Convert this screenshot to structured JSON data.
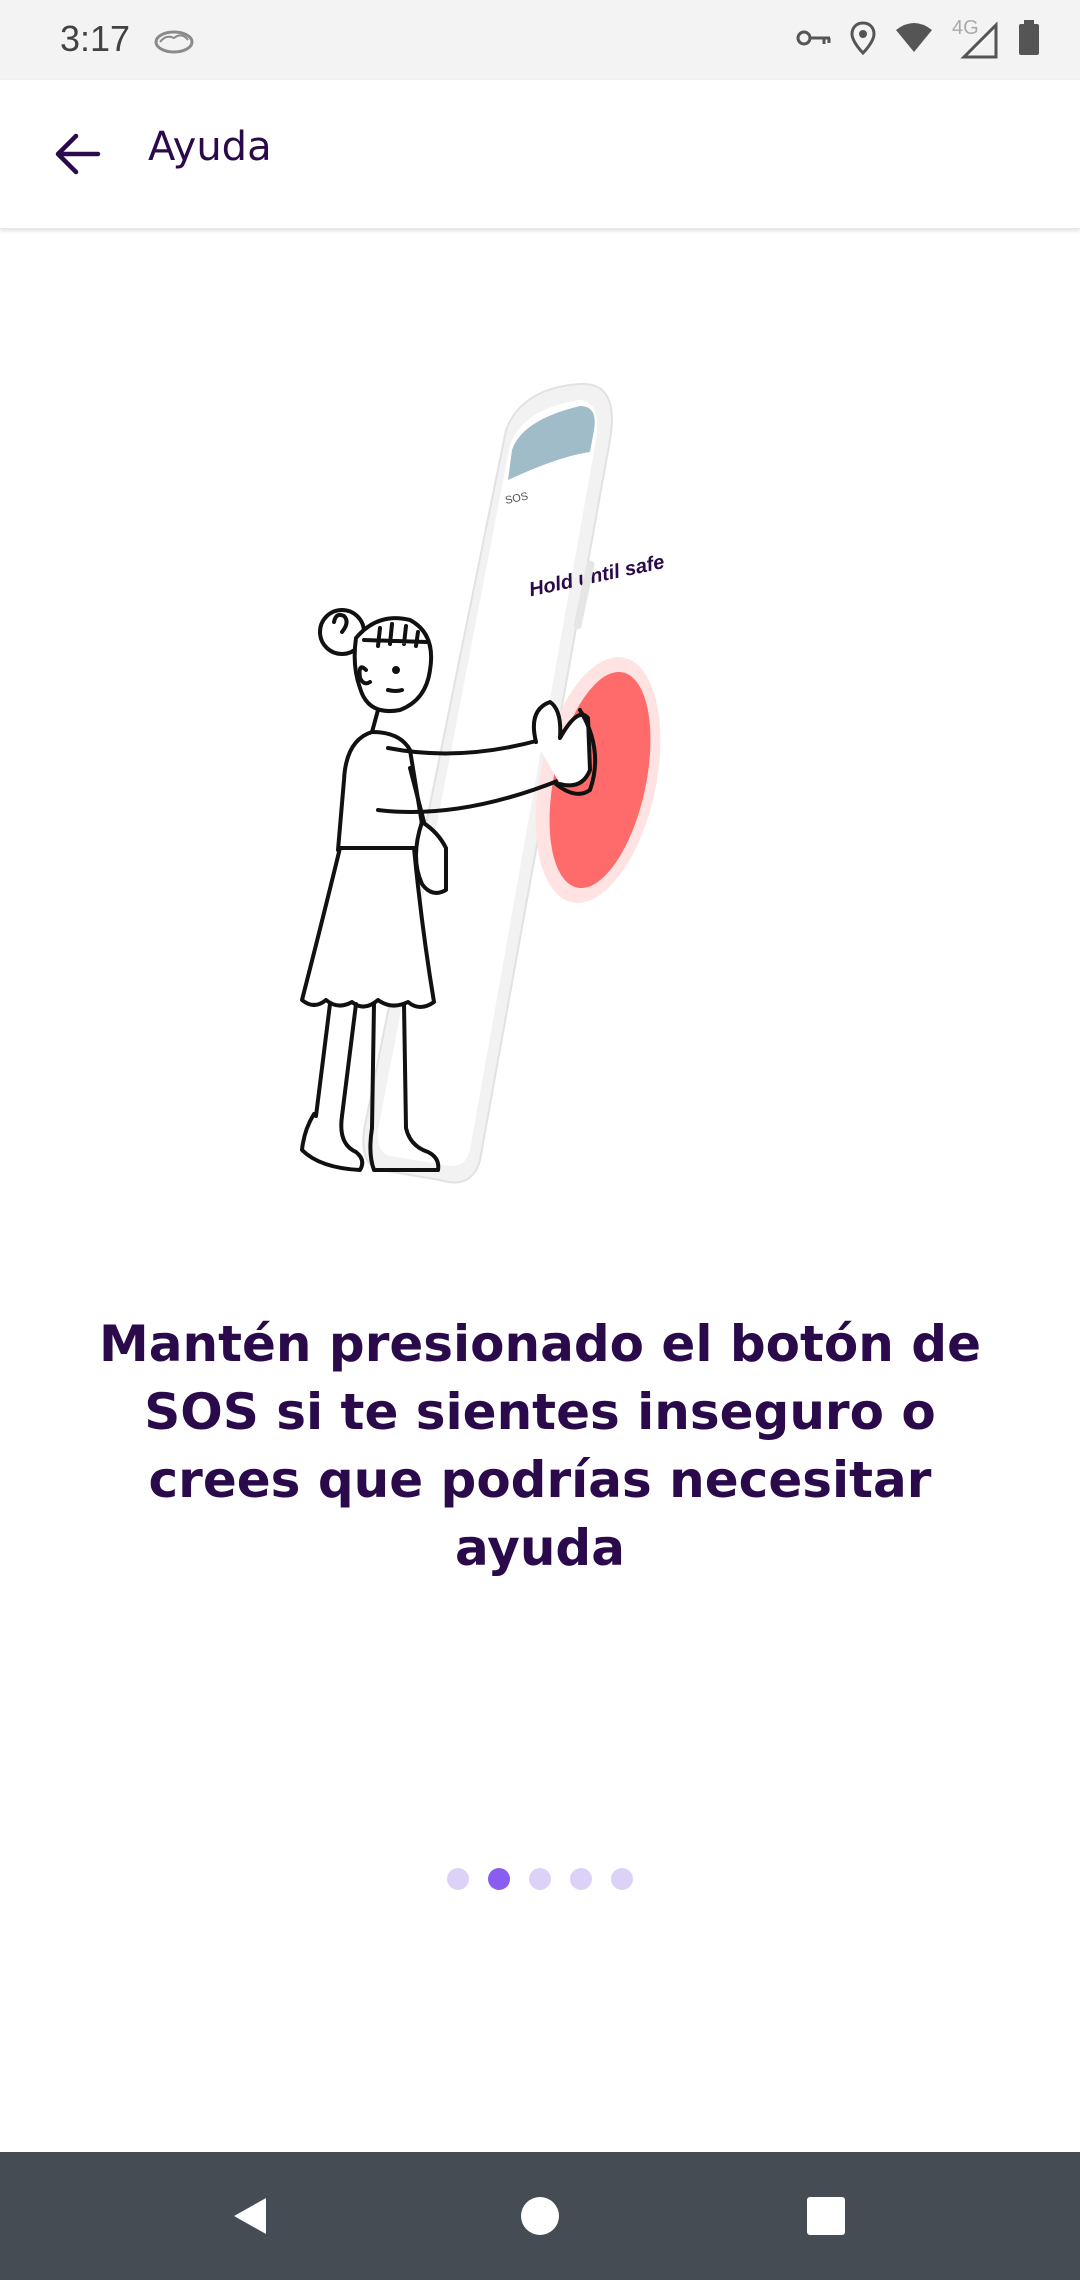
{
  "status_bar": {
    "time": "3:17",
    "network_label": "4G",
    "icons": [
      "weather-icon",
      "vpn-key-icon",
      "location-icon",
      "wifi-icon",
      "signal-icon",
      "battery-icon"
    ]
  },
  "app_bar": {
    "title": "Ayuda",
    "back_icon": "arrow-back-icon"
  },
  "onboarding": {
    "illustration": {
      "screen_title": "Hold until safe",
      "screen_header": "SOS"
    },
    "message": "Mantén presionado el botón de SOS si te sientes inseguro o crees que podrías necesitar ayuda",
    "page_count": 5,
    "current_page": 2
  },
  "nav_bar": {
    "icons": [
      "nav-back-icon",
      "nav-home-icon",
      "nav-recents-icon"
    ]
  },
  "colors": {
    "title_text": "#2a0a4a",
    "dot_active": "#8a5cf0",
    "dot_inactive": "#dcd2f8",
    "sos_button": "#ff6b6b",
    "nav_bar": "#454c53",
    "status_bar": "#f3f3f3"
  }
}
